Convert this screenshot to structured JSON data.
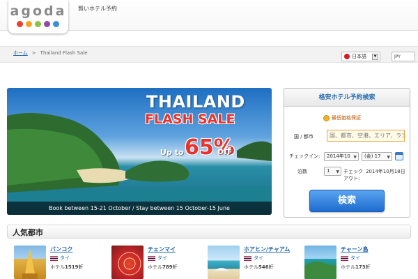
{
  "header": {
    "logo_text": "agoda",
    "logo_dots": [
      "#e8432f",
      "#f4a21c",
      "#8dc43e",
      "#8b4da8",
      "#3a8fd6"
    ],
    "tagline": "賢いホテル予約"
  },
  "breadcrumb": {
    "home": "ホーム",
    "separator": ">",
    "current": "Thailand Flash Sale"
  },
  "language": {
    "label": "日本語",
    "icon": "japan-flag-icon"
  },
  "currency": {
    "label": "JPY"
  },
  "banner": {
    "title": "THAILAND",
    "subtitle": "FLASH SALE",
    "upto": "Up to",
    "discount": "65%",
    "off": "off",
    "dates": "Book between 15-21 October / Stay between 15 October-15 June"
  },
  "search": {
    "title": "格安ホテル予約検索",
    "guarantee": "最低価格保証",
    "city_label": "国 / 都市",
    "city_placeholder": "国、都市、空港、エリア、ランドマーク",
    "checkin_label": "チェックイン:",
    "checkin_month": "2014年10",
    "checkin_day": "(金) 17",
    "nights_label": "泊数",
    "nights_value": "1",
    "checkout_label": "チェック\nアウト:",
    "checkout_label_line1": "チェック",
    "checkout_label_line2": "アウト:",
    "checkout_date": "2014年10月18日",
    "button": "検索"
  },
  "popular": {
    "title": "人気都市",
    "cities": [
      {
        "name": "バンコク",
        "country": "タイ",
        "count_prefix": "ホテル",
        "count": "1519",
        "count_suffix": "軒"
      },
      {
        "name": "チェンマイ",
        "country": "タイ",
        "count_prefix": "ホテル",
        "count": "789",
        "count_suffix": "軒"
      },
      {
        "name": "ホアヒン/チャアム",
        "country": "タイ",
        "count_prefix": "ホテル",
        "count": "546",
        "count_suffix": "軒"
      },
      {
        "name": "チャーン島",
        "country": "タイ",
        "count_prefix": "ホテル",
        "count": "173",
        "count_suffix": "軒"
      }
    ]
  },
  "colors": {
    "link": "#2266aa",
    "accent_red": "#e8322b",
    "search_button": "#1e6cd0"
  }
}
